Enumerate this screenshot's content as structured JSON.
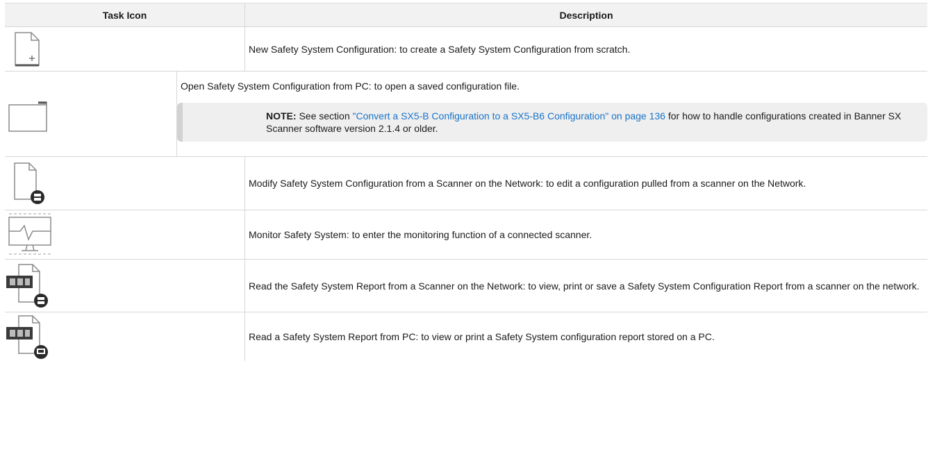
{
  "header": {
    "task_icon": "Task Icon",
    "description": "Description"
  },
  "rows": [
    {
      "icon": "new-file-icon",
      "text": "New Safety System Configuration: to create a Safety System Configuration from scratch."
    },
    {
      "icon": "folder-icon",
      "text": "Open Safety System Configuration from PC: to open a saved configuration file."
    },
    {
      "icon": "file-scanner-icon",
      "text": "Modify Safety System Configuration from a Scanner on the Network: to edit a configuration pulled from a scanner on the Network."
    },
    {
      "icon": "monitor-icon",
      "text": "Monitor Safety System: to enter the monitoring function of a connected scanner."
    },
    {
      "icon": "pdf-scanner-icon",
      "text": "Read the Safety System Report from a Scanner on the Network: to view, print or save a Safety System Configuration Report from a scanner on the network."
    },
    {
      "icon": "pdf-pc-icon",
      "text": "Read a Safety System Report from PC: to view or print a Safety System configuration report stored on a PC."
    }
  ],
  "note": {
    "label": "NOTE:",
    "prefix": "See section",
    "link": "\"Convert a SX5-B Configuration to a SX5-B6 Configuration\" on page 136",
    "suffix": "for how to handle configurations created in Banner SX Scanner software version 2.1.4 or older."
  }
}
